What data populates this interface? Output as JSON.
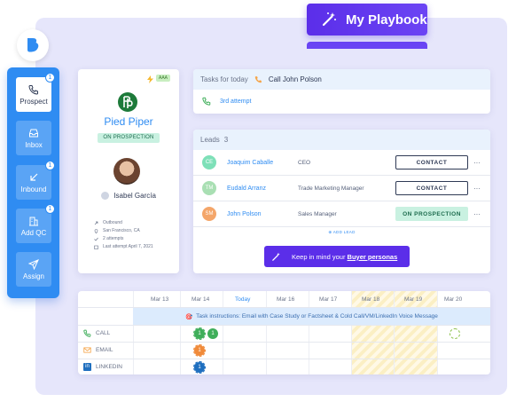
{
  "playbook": {
    "label": "My Playbook"
  },
  "sidebar": {
    "items": [
      {
        "label": "Prospect",
        "badge": "1",
        "icon": "phone-icon"
      },
      {
        "label": "Inbox",
        "badge": "",
        "icon": "inbox-icon"
      },
      {
        "label": "Inbound",
        "badge": "1",
        "icon": "inbound-arrow-icon"
      },
      {
        "label": "Add QC",
        "badge": "1",
        "icon": "building-icon"
      },
      {
        "label": "Assign",
        "badge": "",
        "icon": "send-icon"
      }
    ]
  },
  "company": {
    "name": "Pied Piper",
    "tag": "AAA",
    "status": "ON PROSPECTION",
    "contact": "Isabel García",
    "meta": [
      {
        "icon": "outbound-icon",
        "text": "Outbound"
      },
      {
        "icon": "location-icon",
        "text": "San Francisco, CA"
      },
      {
        "icon": "check-icon",
        "text": "2 attempts"
      },
      {
        "icon": "calendar-icon",
        "text": "Last attempt April 7, 2021"
      }
    ]
  },
  "tasks": {
    "title": "Tasks for today",
    "task": "Call John Polson",
    "attempt": "3rd attempt"
  },
  "leads": {
    "title": "Leads",
    "count": "3",
    "rows": [
      {
        "initials": "CE",
        "name": "Joaquim Caballe",
        "role": "CEO",
        "action": "CONTACT",
        "color": "#7ee0b8"
      },
      {
        "initials": "TM",
        "name": "Eudald Arranz",
        "role": "Trade Marketing Manager",
        "action": "CONTACT",
        "color": "#a9dfb3"
      },
      {
        "initials": "SM",
        "name": "John Polson",
        "role": "Sales Manager",
        "action": "ON PROSPECTION",
        "color": "#f4a66a"
      }
    ],
    "add_lead": "ADD LEAD",
    "persona_prefix": "Keep in mind your",
    "persona_link": "Buyer personas"
  },
  "timeline": {
    "days": [
      "Mar 13",
      "Mar 14",
      "Today",
      "Mar 16",
      "Mar 17",
      "Mar 18",
      "Mar 19",
      "Mar 20"
    ],
    "instruction": "Task instructions: Email with Case Study or Factsheet & Cold Call/VM/LinkedIn Voice Message",
    "channels": [
      {
        "label": "CALL",
        "icon": "phone-icon"
      },
      {
        "label": "EMAIL",
        "icon": "mail-icon"
      },
      {
        "label": "LINKEDIN",
        "icon": "linkedin-icon"
      }
    ],
    "call_counts": [
      "1",
      "1"
    ],
    "email_count": "1",
    "linkedin_count": "1"
  }
}
